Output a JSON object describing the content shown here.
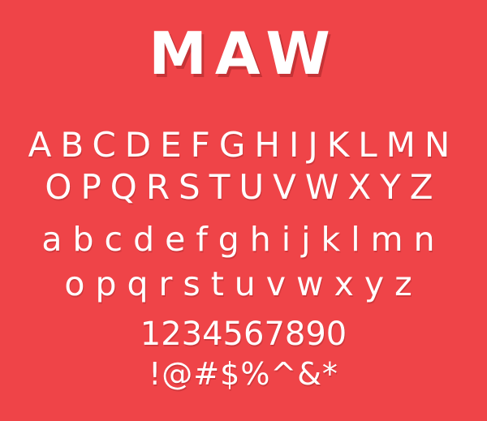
{
  "title": "MAW",
  "rows": {
    "uppercase_1": "ABCDEFGHIJKLMN",
    "uppercase_2": "OPQRSTUVWXYZ",
    "lowercase_1": "abcdefghijklmn",
    "lowercase_2": "opqrstuvwxyz",
    "digits": "1234567890",
    "symbols": "!@#$%^&*"
  },
  "colors": {
    "background": "#ef4448",
    "text": "#ffffff"
  }
}
